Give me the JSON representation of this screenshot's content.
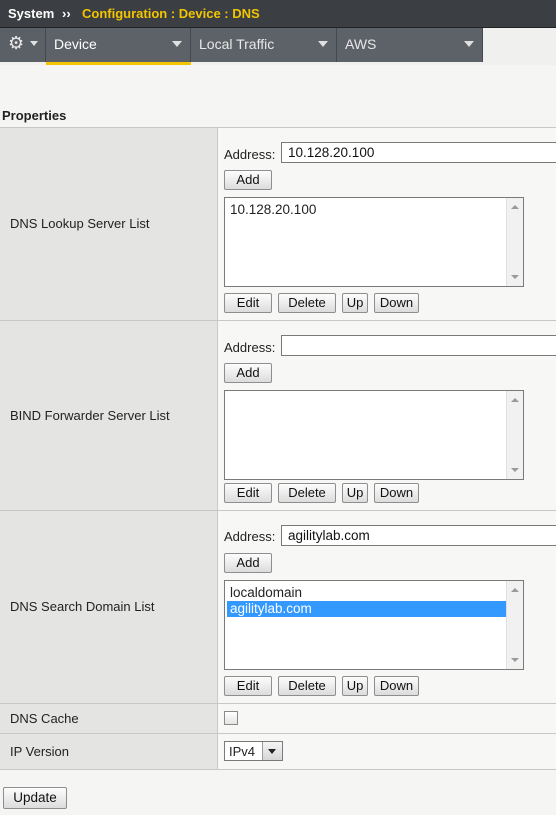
{
  "breadcrumb": {
    "root": "System",
    "separator": "››",
    "path": "Configuration : Device : DNS"
  },
  "tabs": [
    {
      "label": "Device",
      "active": true
    },
    {
      "label": "Local Traffic",
      "active": false
    },
    {
      "label": "AWS",
      "active": false
    }
  ],
  "section_title": "Properties",
  "dns_lookup": {
    "label": "DNS Lookup Server List",
    "address_label": "Address:",
    "address_value": "10.128.20.100",
    "add_label": "Add",
    "items": [
      "10.128.20.100"
    ]
  },
  "bind_forwarder": {
    "label": "BIND Forwarder Server List",
    "address_label": "Address:",
    "address_value": "",
    "add_label": "Add"
  },
  "search_domain": {
    "label": "DNS Search Domain List",
    "address_label": "Address:",
    "address_value": "agilitylab.com",
    "add_label": "Add",
    "items": [
      "localdomain",
      "agilitylab.com"
    ],
    "selected_index": 1
  },
  "list_buttons": {
    "edit": "Edit",
    "delete": "Delete",
    "up": "Up",
    "down": "Down"
  },
  "dns_cache": {
    "label": "DNS Cache",
    "checked": false
  },
  "ip_version": {
    "label": "IP Version",
    "value": "IPv4"
  },
  "update_label": "Update",
  "colors": {
    "header_bg": "#3b3e42",
    "breadcrumb_accent": "#f2c500",
    "tab_bg": "#5d6268",
    "active_tab_underline": "#f2c500",
    "selection": "#3399ff"
  }
}
